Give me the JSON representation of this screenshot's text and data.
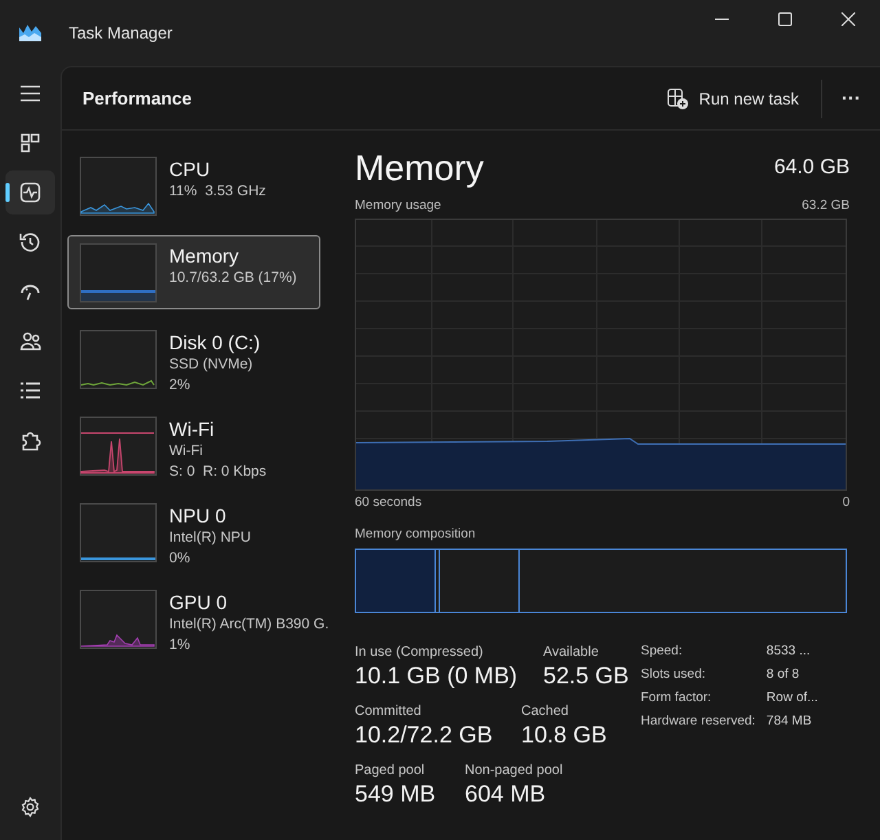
{
  "window": {
    "title": "Task Manager"
  },
  "nav": [
    {
      "selected": false
    },
    {
      "selected": false
    },
    {
      "selected": true
    },
    {
      "selected": false
    },
    {
      "selected": false
    },
    {
      "selected": false
    },
    {
      "selected": false
    },
    {
      "selected": false
    }
  ],
  "header": {
    "title": "Performance",
    "run_new_task": "Run new task",
    "more": "···"
  },
  "devices": [
    {
      "name": "CPU",
      "lines": [
        "11%  3.53 GHz"
      ],
      "color": "#3a96dd",
      "selected": false
    },
    {
      "name": "Memory",
      "lines": [
        "10.7/63.2 GB (17%)"
      ],
      "color": "#2f6fc4",
      "selected": true
    },
    {
      "name": "Disk 0 (C:)",
      "lines": [
        "SSD (NVMe)",
        "2%"
      ],
      "color": "#6ea53a",
      "selected": false
    },
    {
      "name": "Wi-Fi",
      "lines": [
        "Wi-Fi",
        "S: 0  R: 0 Kbps"
      ],
      "color": "#c8466e",
      "selected": false
    },
    {
      "name": "NPU 0",
      "lines": [
        "Intel(R) NPU",
        "0%"
      ],
      "color": "#3a96dd",
      "selected": false
    },
    {
      "name": "GPU 0",
      "lines": [
        "Intel(R) Arc(TM) B390 G.",
        "1%"
      ],
      "color": "#a23fb0",
      "selected": false
    }
  ],
  "detail": {
    "title": "Memory",
    "total": "64.0 GB",
    "usage_label": "Memory usage",
    "usage_max": "63.2 GB",
    "time_start": "60 seconds",
    "time_end": "0",
    "composition_label": "Memory composition",
    "stats": [
      {
        "label": "In use (Compressed)",
        "value": "10.1 GB (0 MB)"
      },
      {
        "label": "Available",
        "value": "52.5 GB"
      },
      {
        "label": "Committed",
        "value": "10.2/72.2 GB"
      },
      {
        "label": "Cached",
        "value": "10.8 GB"
      },
      {
        "label": "Paged pool",
        "value": "549 MB"
      },
      {
        "label": "Non-paged pool",
        "value": "604 MB"
      }
    ],
    "properties": [
      {
        "label": "Speed:",
        "value": "8533 ..."
      },
      {
        "label": "Slots used:",
        "value": "8 of 8"
      },
      {
        "label": "Form factor:",
        "value": "Row of..."
      },
      {
        "label": "Hardware reserved:",
        "value": "784 MB"
      }
    ]
  }
}
